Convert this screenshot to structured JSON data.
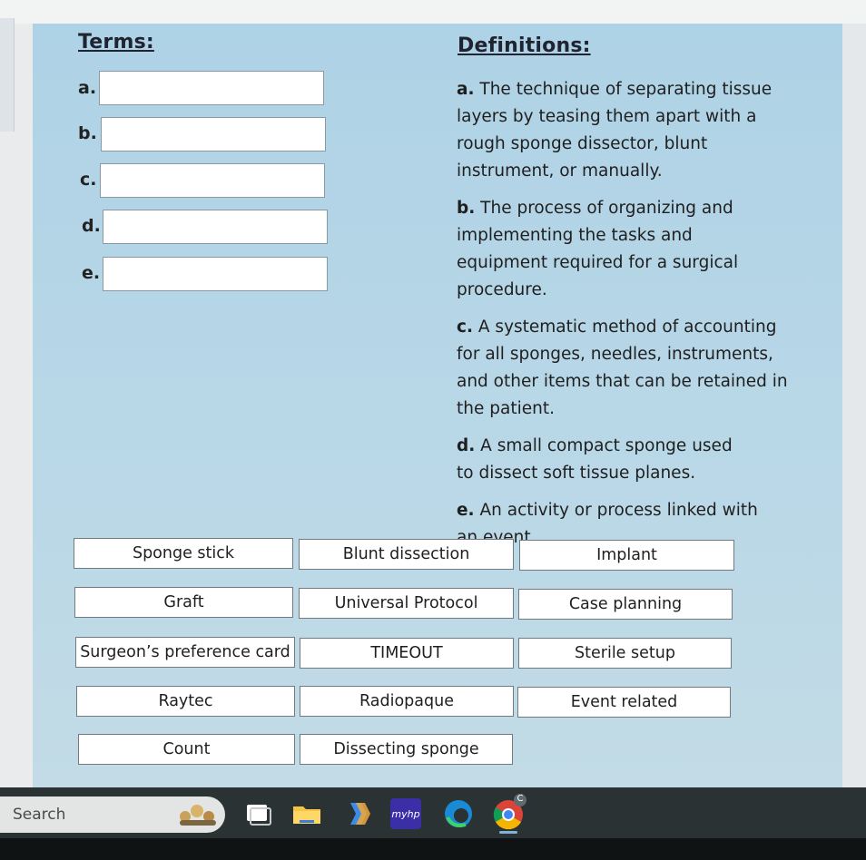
{
  "headings": {
    "terms": "Terms:",
    "definitions": "Definitions:"
  },
  "terms": [
    "a.",
    "b.",
    "c.",
    "d.",
    "e."
  ],
  "definitions": [
    {
      "letter": "a.",
      "text": "The technique of separating tissue layers by teasing them apart with a rough sponge dissector, blunt instrument, or manually."
    },
    {
      "letter": "b.",
      "text": "The process of organizing and implementing the tasks and equipment required for a surgical procedure."
    },
    {
      "letter": "c.",
      "text": "A systematic method of accounting for all sponges, needles, instruments, and other items that can be retained in the patient."
    },
    {
      "letter": "d.",
      "text": "A small compact sponge used to dissect soft tissue planes."
    },
    {
      "letter": "e.",
      "text": "An activity or process linked with an event."
    }
  ],
  "options": [
    "Sponge stick",
    "Blunt dissection",
    "Implant",
    "Graft",
    "Universal Protocol",
    "Case planning",
    "Surgeon’s preference card",
    "TIMEOUT",
    "Sterile setup",
    "Raytec",
    "Radiopaque",
    "Event related",
    "Count",
    "Dissecting sponge"
  ],
  "taskbar": {
    "search_label": "Search",
    "icons": [
      "search-highlight-icon",
      "task-view-icon",
      "file-explorer-icon",
      "copilot-icon",
      "myhp-icon",
      "edge-icon",
      "chrome-icon"
    ],
    "myhp_text": "myhp",
    "chrome_badge": "C"
  },
  "colors": {
    "panel": "#b4d5e7",
    "taskbar": "#2a3234",
    "box_border": "#6f7b80"
  }
}
